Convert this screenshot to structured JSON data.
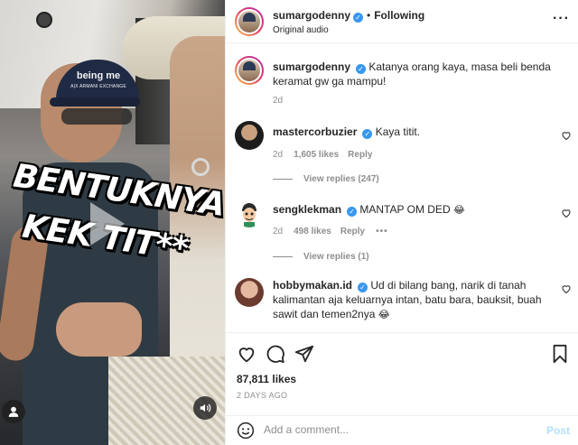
{
  "video": {
    "overlay_line1": "BENTUKNYA",
    "overlay_line2": "KEK TIT**",
    "cap_text_big": "being me",
    "cap_text_small": "A|X ARMANI EXCHANGE",
    "controls": {
      "user_icon": "person-icon",
      "sound_icon": "speaker-icon",
      "play_icon": "play-icon"
    }
  },
  "header": {
    "username": "sumargodenny",
    "separator": "•",
    "follow_status": "Following",
    "audio": "Original audio",
    "more_icon": "more-horizontal-icon"
  },
  "caption": {
    "username": "sumargodenny",
    "text": "Katanya orang kaya, masa beli benda keramat gw ga mampu!",
    "time": "2d"
  },
  "comments": [
    {
      "username": "mastercorbuzier",
      "text": "Kaya titit.",
      "time": "2d",
      "likes": "1,605 likes",
      "reply": "Reply",
      "view_replies": "View replies (247)"
    },
    {
      "username": "sengklekman",
      "text": "MANTAP OM DED",
      "emoji": "😂",
      "time": "2d",
      "likes": "498 likes",
      "reply": "Reply",
      "more": "•••",
      "view_replies": "View replies (1)"
    },
    {
      "username": "hobbymakan.id",
      "text": "Ud di bilang bang, narik di tanah kalimantan aja keluarnya intan, batu bara, bauksit, buah sawit dan temen2nya",
      "emoji": "😂"
    }
  ],
  "actions": {
    "likes": "87,811 likes",
    "posted": "2 DAYS AGO",
    "icons": [
      "heart-icon",
      "comment-icon",
      "share-icon",
      "bookmark-icon"
    ]
  },
  "add_comment": {
    "placeholder": "Add a comment...",
    "post_label": "Post"
  },
  "colors": {
    "verified": "#3897f0",
    "muted_text": "#8e8e8e",
    "post_disabled": "#b2dffc",
    "divider": "#efefef"
  }
}
